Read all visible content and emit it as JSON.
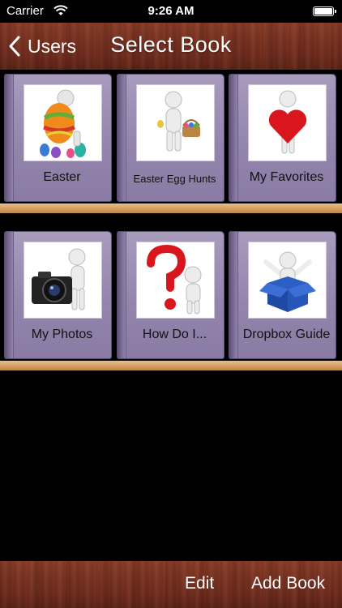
{
  "status_bar": {
    "carrier": "Carrier",
    "time": "9:26 AM"
  },
  "nav": {
    "back_label": "Users",
    "title": "Select Book"
  },
  "books": [
    {
      "title": "Easter",
      "icon": "easter-egg-figure-icon"
    },
    {
      "title": "Easter Egg Hunts",
      "icon": "egg-basket-figure-icon"
    },
    {
      "title": "My Favorites",
      "icon": "heart-figure-icon"
    },
    {
      "title": "My Photos",
      "icon": "camera-figure-icon"
    },
    {
      "title": "How Do I...",
      "icon": "question-mark-figure-icon"
    },
    {
      "title": "Dropbox Guide",
      "icon": "dropbox-figure-icon"
    }
  ],
  "toolbar": {
    "edit_label": "Edit",
    "add_label": "Add Book"
  },
  "colors": {
    "wood": "#7a3322",
    "book_cover": "#9485ad",
    "shelf_plank": "#d9a566"
  }
}
